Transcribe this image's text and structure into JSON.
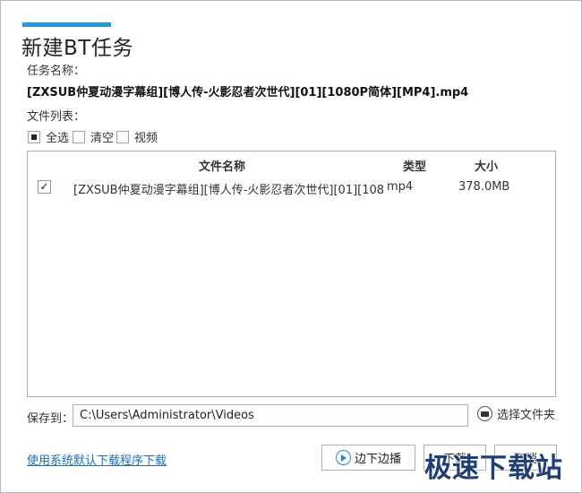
{
  "window": {
    "title": "新建BT任务"
  },
  "task": {
    "name_label": "任务名称：",
    "name_value": "[ZXSUB仲夏动漫字幕组][博人传-火影忍者次世代][01][1080P简体][MP4].mp4"
  },
  "files": {
    "list_label": "文件列表：",
    "filters": [
      {
        "label": "全选",
        "state": "partial"
      },
      {
        "label": "清空",
        "state": "unchecked"
      },
      {
        "label": "视频",
        "state": "unchecked"
      }
    ],
    "columns": {
      "name": "文件名称",
      "type": "类型",
      "size": "大小"
    },
    "rows": [
      {
        "checked": "✓",
        "name": "[ZXSUB仲夏动漫字幕组][博人传-火影忍者次世代][01][108",
        "type": "mp4",
        "size": "378.0MB"
      }
    ]
  },
  "save": {
    "label": "保存到：",
    "path": "C:\\Users\\Administrator\\Videos",
    "browse_label": "选择文件夹"
  },
  "footer": {
    "default_link": "使用系统默认下载程序下载",
    "play_label": "边下边播",
    "download_label": "下载",
    "cancel_label": "取消"
  },
  "watermark": "极速下载站",
  "colors": {
    "accent": "#1e9be0",
    "link": "#1a6fc2",
    "play": "#1e88d6"
  }
}
